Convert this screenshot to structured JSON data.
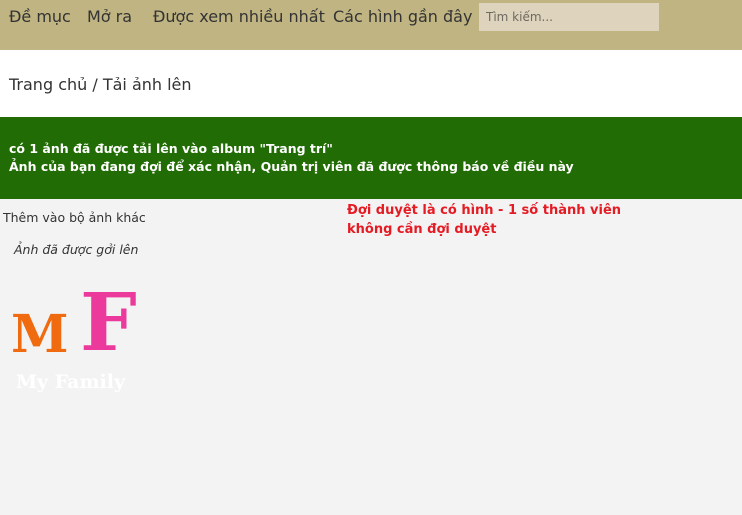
{
  "nav": {
    "items": [
      {
        "label": "Đề mục"
      },
      {
        "label": "Mở ra"
      },
      {
        "label": "Được xem nhiều nhất"
      },
      {
        "label": "Các hình gần đây"
      }
    ],
    "search": {
      "placeholder": "Tìm kiếm...",
      "value": ""
    }
  },
  "breadcrumb": {
    "home": "Trang chủ",
    "separator": " / ",
    "current": "Tải ảnh lên"
  },
  "banner": {
    "line1": "có 1 ảnh đã được tải lên vào album \"Trang trí\"",
    "line2": "Ảnh của bạn đang đợi để xác nhận, Quản trị viên đã được thông báo về điều này"
  },
  "content": {
    "add_more_link": "Thêm vào bộ ảnh khác",
    "uploaded_caption": "Ảnh đã được gởi lên"
  },
  "annotation": {
    "line1": "Đợi duyệt là có hình - 1 số thành viên",
    "line2": "không cần đợi duyệt"
  },
  "thumbnail": {
    "logo_m": "M",
    "logo_f": "F",
    "logo_text": "My Family"
  },
  "colors": {
    "nav_bg": "#bfb482",
    "banner_bg": "#216c04",
    "annotation": "#e51b24",
    "logo_m": "#f06a0f",
    "logo_f": "#ec3a9c"
  }
}
